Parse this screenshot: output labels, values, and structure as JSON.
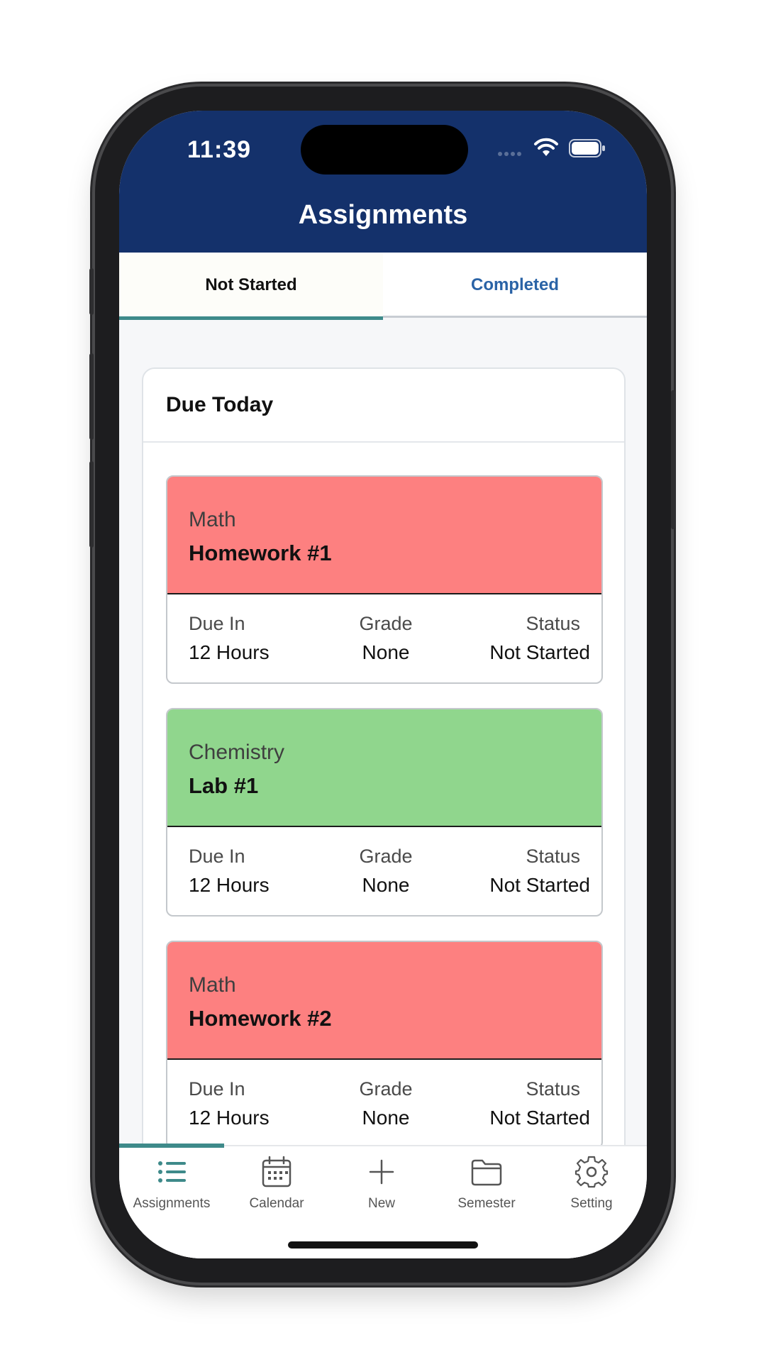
{
  "status_bar": {
    "time": "11:39"
  },
  "header": {
    "title": "Assignments"
  },
  "tabs": [
    {
      "label": "Not Started",
      "active": true
    },
    {
      "label": "Completed",
      "active": false
    }
  ],
  "section": {
    "title": "Due Today"
  },
  "labels": {
    "due_in": "Due In",
    "grade": "Grade",
    "status": "Status"
  },
  "assignments": [
    {
      "subject": "Math",
      "name": "Homework #1",
      "due_in": "12 Hours",
      "grade": "None",
      "status": "Not Started",
      "color": "#fd8080"
    },
    {
      "subject": "Chemistry",
      "name": "Lab #1",
      "due_in": "12 Hours",
      "grade": "None",
      "status": "Not Started",
      "color": "#90d68d"
    },
    {
      "subject": "Math",
      "name": "Homework #2",
      "due_in": "12 Hours",
      "grade": "None",
      "status": "Not Started",
      "color": "#fd8080"
    }
  ],
  "nav": [
    {
      "label": "Assignments",
      "icon": "list-icon",
      "active": true
    },
    {
      "label": "Calendar",
      "icon": "calendar-icon",
      "active": false
    },
    {
      "label": "New",
      "icon": "plus-icon",
      "active": false
    },
    {
      "label": "Semester",
      "icon": "folder-icon",
      "active": false
    },
    {
      "label": "Setting",
      "icon": "gear-icon",
      "active": false
    }
  ],
  "colors": {
    "header_bg": "#14316b",
    "accent": "#3e8a8a",
    "link": "#2a63a6",
    "math": "#fd8080",
    "chemistry": "#90d68d"
  }
}
